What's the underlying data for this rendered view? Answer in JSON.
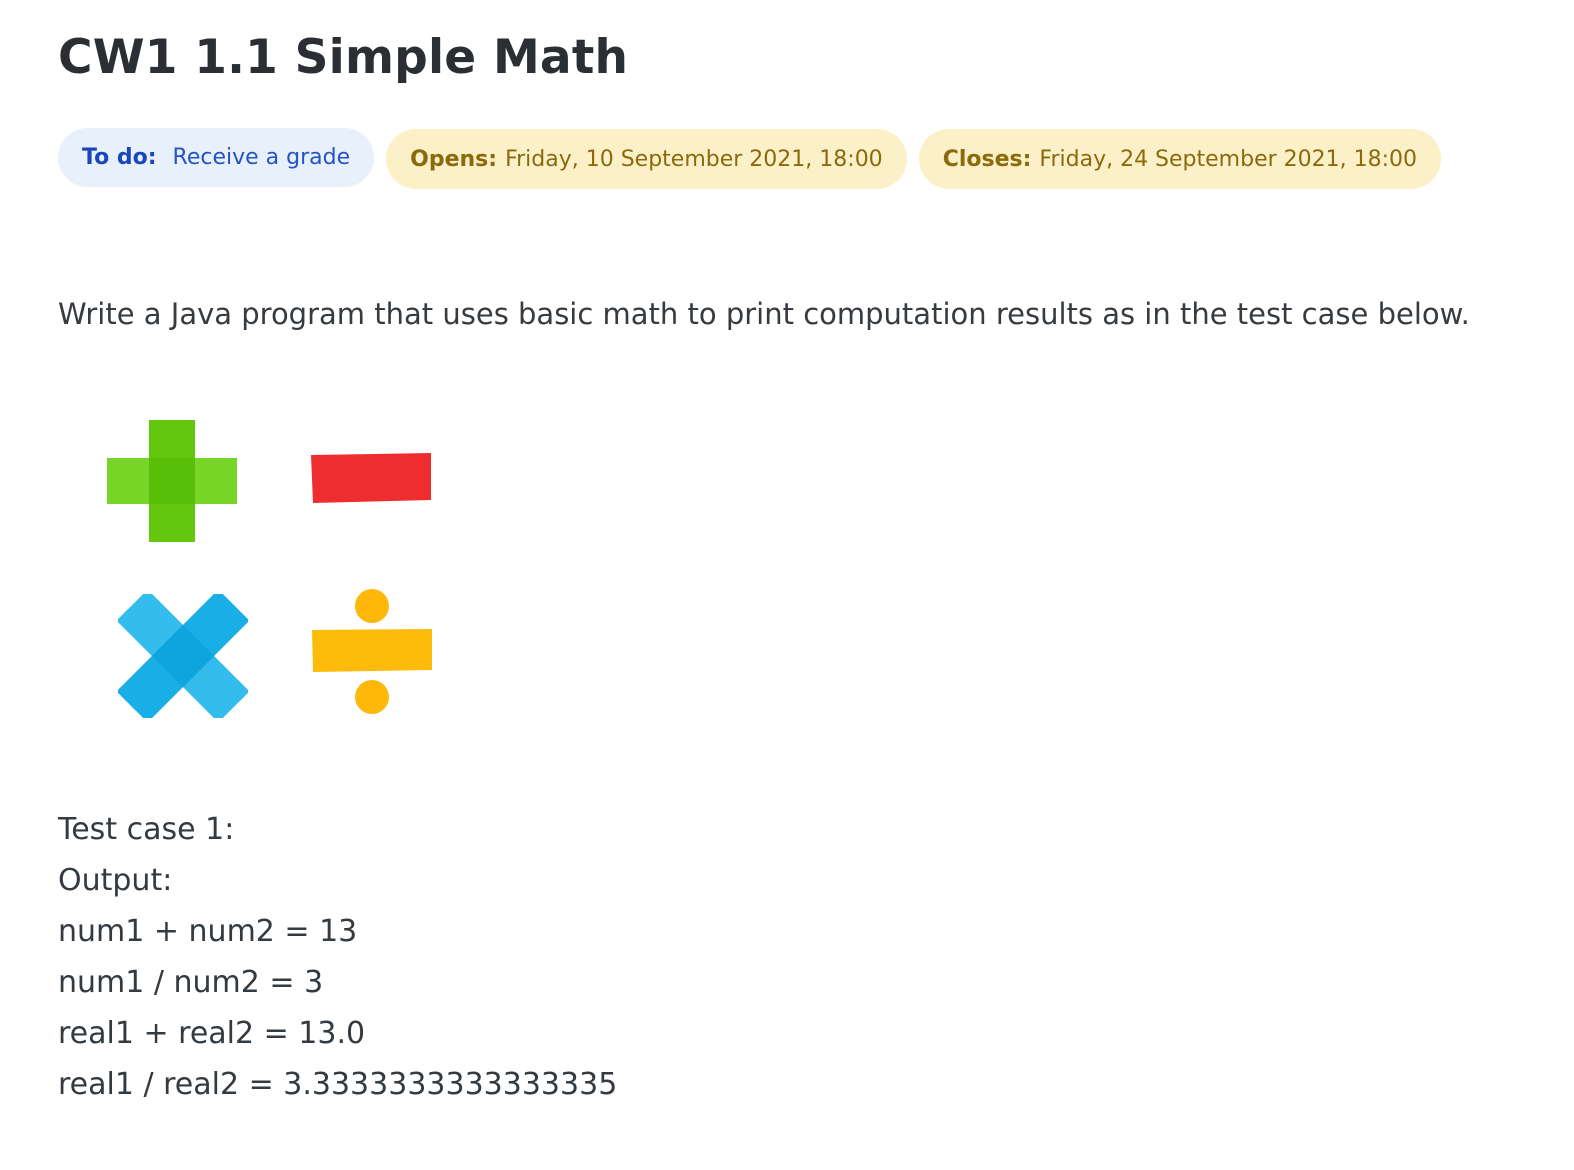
{
  "page": {
    "title": "CW1 1.1 Simple Math"
  },
  "badges": {
    "todo": {
      "key": "To do:",
      "value": "Receive a grade"
    },
    "opens": {
      "key": "Opens:",
      "value": "Friday, 10 September 2021, 18:00"
    },
    "closes": {
      "key": "Closes:",
      "value": "Friday, 24 September 2021, 18:00"
    }
  },
  "description": {
    "intro": "Write a Java program that uses basic math to print computation results as in the test case below."
  },
  "image": {
    "icons": [
      "plus-icon",
      "minus-icon",
      "multiply-icon",
      "divide-icon"
    ],
    "colors": {
      "plus": "#66cc11",
      "minus": "#ef3030",
      "multiply": "#1ab0e6",
      "divide": "#ffb90a"
    }
  },
  "test_case": {
    "heading": "Test case 1:",
    "output_label": "Output:",
    "lines": [
      "num1 + num2 = 13",
      "num1 / num2 = 3",
      "real1 + real2 = 13.0",
      "real1 / real2 = 3.3333333333333335"
    ]
  }
}
